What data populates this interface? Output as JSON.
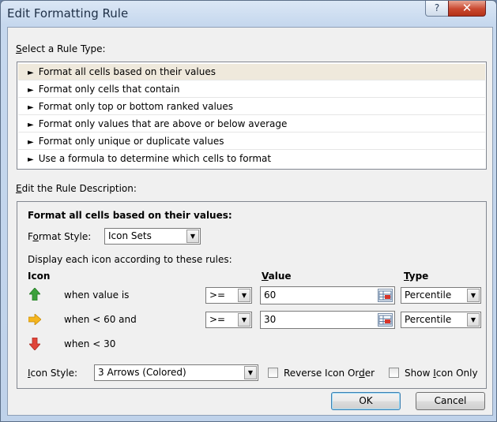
{
  "window": {
    "title": "Edit Formatting Rule",
    "help_glyph": "?",
    "close_glyph": "✕"
  },
  "rule_type": {
    "heading_prefix": "",
    "heading_accel": "S",
    "heading_rest": "elect a Rule Type:",
    "items": [
      "Format all cells based on their values",
      "Format only cells that contain",
      "Format only top or bottom ranked values",
      "Format only values that are above or below average",
      "Format only unique or duplicate values",
      "Use a formula to determine which cells to format"
    ],
    "selected_index": 0,
    "bullet": "►"
  },
  "description": {
    "heading_accel": "E",
    "heading_rest": "dit the Rule Description:",
    "subheading": "Format all cells based on their values:",
    "format_style_label_pre": "F",
    "format_style_label_accel": "o",
    "format_style_label_post": "rmat Style:",
    "format_style_value": "Icon Sets",
    "display_text": "Display each icon according to these rules:",
    "col_icon": "Icon",
    "col_value_accel": "V",
    "col_value_rest": "alue",
    "col_type_accel": "T",
    "col_type_rest": "ype",
    "rows": [
      {
        "icon": "arrow-up-green",
        "text": "when value is",
        "operator": ">=",
        "value": "60",
        "type": "Percentile"
      },
      {
        "icon": "arrow-right-yellow",
        "text": "when < 60 and",
        "operator": ">=",
        "value": "30",
        "type": "Percentile"
      },
      {
        "icon": "arrow-down-red",
        "text": "when < 30"
      }
    ],
    "icon_style_label_pre": "",
    "icon_style_label_accel": "I",
    "icon_style_label_post": "con Style:",
    "icon_style_value": "3 Arrows (Colored)",
    "reverse_pre": "Reverse Icon Or",
    "reverse_accel": "d",
    "reverse_post": "er",
    "show_pre": "Show ",
    "show_accel": "I",
    "show_post": "con Only"
  },
  "buttons": {
    "ok": "OK",
    "cancel": "Cancel"
  },
  "colors": {
    "up_arrow": "#3ca13c",
    "right_arrow": "#f5b51e",
    "down_arrow": "#e0453a",
    "selected_row": "#efe9dc"
  }
}
